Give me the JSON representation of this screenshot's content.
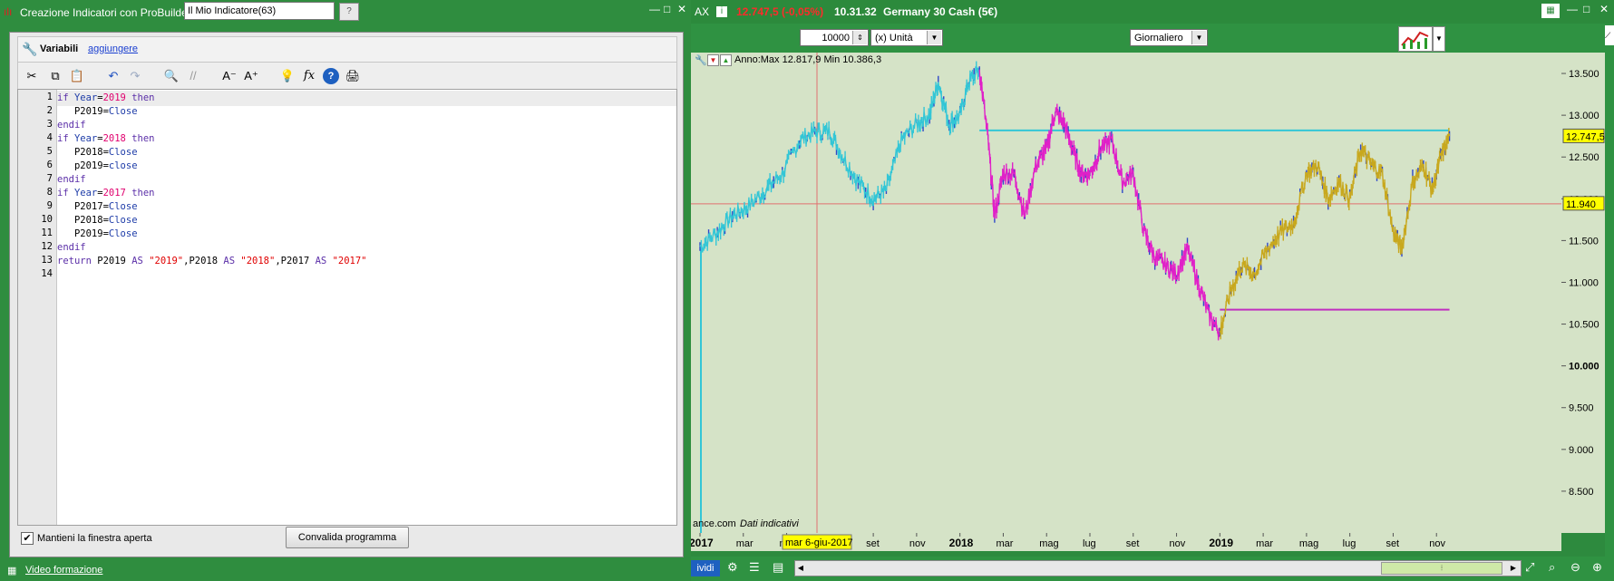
{
  "probuilder": {
    "title": "Creazione Indicatori con ProBuilder",
    "indicator_name": "Il Mio Indicatore(63)",
    "variables_label": "Variabili",
    "add_link": "aggiungere",
    "code_lines": [
      {
        "n": "1",
        "parts": [
          {
            "t": "if ",
            "c": "kw"
          },
          {
            "t": "Year",
            "c": "fn"
          },
          {
            "t": "=",
            "c": ""
          },
          {
            "t": "2019",
            "c": "num"
          },
          {
            "t": " then",
            "c": "kw"
          }
        ]
      },
      {
        "n": "2",
        "parts": [
          {
            "t": "   P2019=",
            "c": ""
          },
          {
            "t": "Close",
            "c": "fn"
          }
        ]
      },
      {
        "n": "3",
        "parts": [
          {
            "t": "endif",
            "c": "kw"
          }
        ]
      },
      {
        "n": "4",
        "parts": [
          {
            "t": "if ",
            "c": "kw"
          },
          {
            "t": "Year",
            "c": "fn"
          },
          {
            "t": "=",
            "c": ""
          },
          {
            "t": "2018",
            "c": "num"
          },
          {
            "t": " then",
            "c": "kw"
          }
        ]
      },
      {
        "n": "5",
        "parts": [
          {
            "t": "   P2018=",
            "c": ""
          },
          {
            "t": "Close",
            "c": "fn"
          }
        ]
      },
      {
        "n": "6",
        "parts": [
          {
            "t": "   p2019=",
            "c": ""
          },
          {
            "t": "close",
            "c": "fn"
          }
        ]
      },
      {
        "n": "7",
        "parts": [
          {
            "t": "endif",
            "c": "kw"
          }
        ]
      },
      {
        "n": "8",
        "parts": [
          {
            "t": "if ",
            "c": "kw"
          },
          {
            "t": "Year",
            "c": "fn"
          },
          {
            "t": "=",
            "c": ""
          },
          {
            "t": "2017",
            "c": "num"
          },
          {
            "t": " then",
            "c": "kw"
          }
        ]
      },
      {
        "n": "9",
        "parts": [
          {
            "t": "   P2017=",
            "c": ""
          },
          {
            "t": "Close",
            "c": "fn"
          }
        ]
      },
      {
        "n": "10",
        "parts": [
          {
            "t": "   P2018=",
            "c": ""
          },
          {
            "t": "Close",
            "c": "fn"
          }
        ]
      },
      {
        "n": "11",
        "parts": [
          {
            "t": "   P2019=",
            "c": ""
          },
          {
            "t": "Close",
            "c": "fn"
          }
        ]
      },
      {
        "n": "12",
        "parts": [
          {
            "t": "endif",
            "c": "kw"
          }
        ]
      },
      {
        "n": "13",
        "parts": [
          {
            "t": "return ",
            "c": "kw"
          },
          {
            "t": "P2019 ",
            "c": ""
          },
          {
            "t": "AS",
            "c": "kw"
          },
          {
            "t": " ",
            "c": ""
          },
          {
            "t": "\"2019\"",
            "c": "str"
          },
          {
            "t": ",P2018 ",
            "c": ""
          },
          {
            "t": "AS",
            "c": "kw"
          },
          {
            "t": " ",
            "c": ""
          },
          {
            "t": "\"2018\"",
            "c": "str"
          },
          {
            "t": ",P2017 ",
            "c": ""
          },
          {
            "t": "AS",
            "c": "kw"
          },
          {
            "t": " ",
            "c": ""
          },
          {
            "t": "\"2017\"",
            "c": "str"
          }
        ]
      },
      {
        "n": "14",
        "parts": []
      }
    ],
    "keep_open_label": "Mantieni la finestra aperta",
    "keep_open_checked": true,
    "validate_button": "Convalida programma",
    "video_link": "Video formazione"
  },
  "chart": {
    "title_prefix": "AX",
    "price_change": "12.747,5 (-0,05%)",
    "time": "10.31.32",
    "instrument": "Germany 30 Cash (5€)",
    "quantity": "10000",
    "unit": "(x) Unità",
    "timeframe": "Giornaliero",
    "indicator_label": "Anno:Max 12.817,9 Min 10.386,3",
    "source": "ance.com",
    "source_note": "Dati indicativi",
    "cursor_date": "mar 6-giu-2017",
    "crosshair_value": "11.940",
    "last_value": "12.747,5",
    "bottom_button": "ividi",
    "colors": {
      "price_2017": "#33c6d6",
      "price_2018": "#e020c8",
      "price_2019": "#c8a81e",
      "window_bar": "#2f8d3f",
      "plot_bg": "#d5e3c7"
    }
  },
  "chart_data": {
    "type": "line",
    "title": "",
    "ylim": [
      8000,
      13750
    ],
    "y_ticks": [
      "13.500",
      "13.000",
      "12.500",
      "12.000",
      "11.500",
      "11.000",
      "10.500",
      "10.000",
      "9.500",
      "9.000",
      "8.500"
    ],
    "y_tick_values": [
      13500,
      13000,
      12500,
      12000,
      11500,
      11000,
      10500,
      10000,
      9500,
      9000,
      8500
    ],
    "x_ticks": [
      "2017",
      "mar",
      "mag",
      "set",
      "nov",
      "2018",
      "mar",
      "mag",
      "lug",
      "set",
      "nov",
      "2019",
      "mar",
      "mag",
      "lug",
      "set",
      "nov"
    ],
    "x_tick_values": [
      0,
      2,
      4,
      8,
      10,
      12,
      14,
      16,
      18,
      20,
      22,
      24,
      26,
      28,
      30,
      32,
      34
    ],
    "xlim": [
      0,
      36
    ],
    "series": [
      {
        "name": "2017",
        "color": "#33c6d6",
        "points": [
          [
            0,
            11430
          ],
          [
            0.8,
            11600
          ],
          [
            1.5,
            11800
          ],
          [
            2.2,
            11900
          ],
          [
            3,
            12100
          ],
          [
            3.8,
            12300
          ],
          [
            4.6,
            12700
          ],
          [
            5.3,
            12800
          ],
          [
            6,
            12800
          ],
          [
            6.6,
            12500
          ],
          [
            7.3,
            12200
          ],
          [
            8,
            12000
          ],
          [
            8.6,
            12100
          ],
          [
            9.3,
            12700
          ],
          [
            10,
            12900
          ],
          [
            10.6,
            13000
          ],
          [
            11,
            13400
          ],
          [
            11.5,
            12900
          ],
          [
            12,
            13000
          ],
          [
            12.4,
            13400
          ],
          [
            12.9,
            13550
          ]
        ]
      },
      {
        "name": "2018",
        "color": "#e020c8",
        "points": [
          [
            12.9,
            13550
          ],
          [
            13.3,
            12700
          ],
          [
            13.6,
            11800
          ],
          [
            14,
            12300
          ],
          [
            14.5,
            12300
          ],
          [
            15,
            11800
          ],
          [
            15.5,
            12400
          ],
          [
            16,
            12600
          ],
          [
            16.4,
            13050
          ],
          [
            16.8,
            12900
          ],
          [
            17.2,
            12600
          ],
          [
            17.6,
            12300
          ],
          [
            18,
            12300
          ],
          [
            18.5,
            12600
          ],
          [
            19,
            12700
          ],
          [
            19.5,
            12200
          ],
          [
            20,
            12300
          ],
          [
            20.5,
            11600
          ],
          [
            21,
            11300
          ],
          [
            21.5,
            11200
          ],
          [
            22,
            11100
          ],
          [
            22.5,
            11400
          ],
          [
            23,
            11000
          ],
          [
            23.5,
            10600
          ],
          [
            24,
            10400
          ]
        ]
      },
      {
        "name": "2019",
        "color": "#c8a81e",
        "points": [
          [
            24,
            10400
          ],
          [
            24.5,
            10900
          ],
          [
            25,
            11200
          ],
          [
            25.6,
            11100
          ],
          [
            26.2,
            11400
          ],
          [
            26.8,
            11600
          ],
          [
            27.4,
            11700
          ],
          [
            28,
            12300
          ],
          [
            28.5,
            12400
          ],
          [
            29,
            12000
          ],
          [
            29.5,
            12200
          ],
          [
            30,
            12000
          ],
          [
            30.5,
            12600
          ],
          [
            31,
            12400
          ],
          [
            31.5,
            12300
          ],
          [
            32,
            11600
          ],
          [
            32.4,
            11400
          ],
          [
            32.9,
            12200
          ],
          [
            33.4,
            12400
          ],
          [
            33.8,
            12100
          ],
          [
            34.2,
            12500
          ],
          [
            34.6,
            12750
          ]
        ]
      }
    ],
    "annotations": [
      {
        "name": "2017 max",
        "value": 12817.9,
        "from_x": 12.9,
        "to_x": 34.6,
        "color": "#33c6d6"
      },
      {
        "name": "2019 min",
        "value": 10673,
        "from_x": 24,
        "to_x": 34.6,
        "color": "#c030c0"
      }
    ],
    "crosshair": {
      "x": 5.4,
      "y": 11940
    }
  }
}
